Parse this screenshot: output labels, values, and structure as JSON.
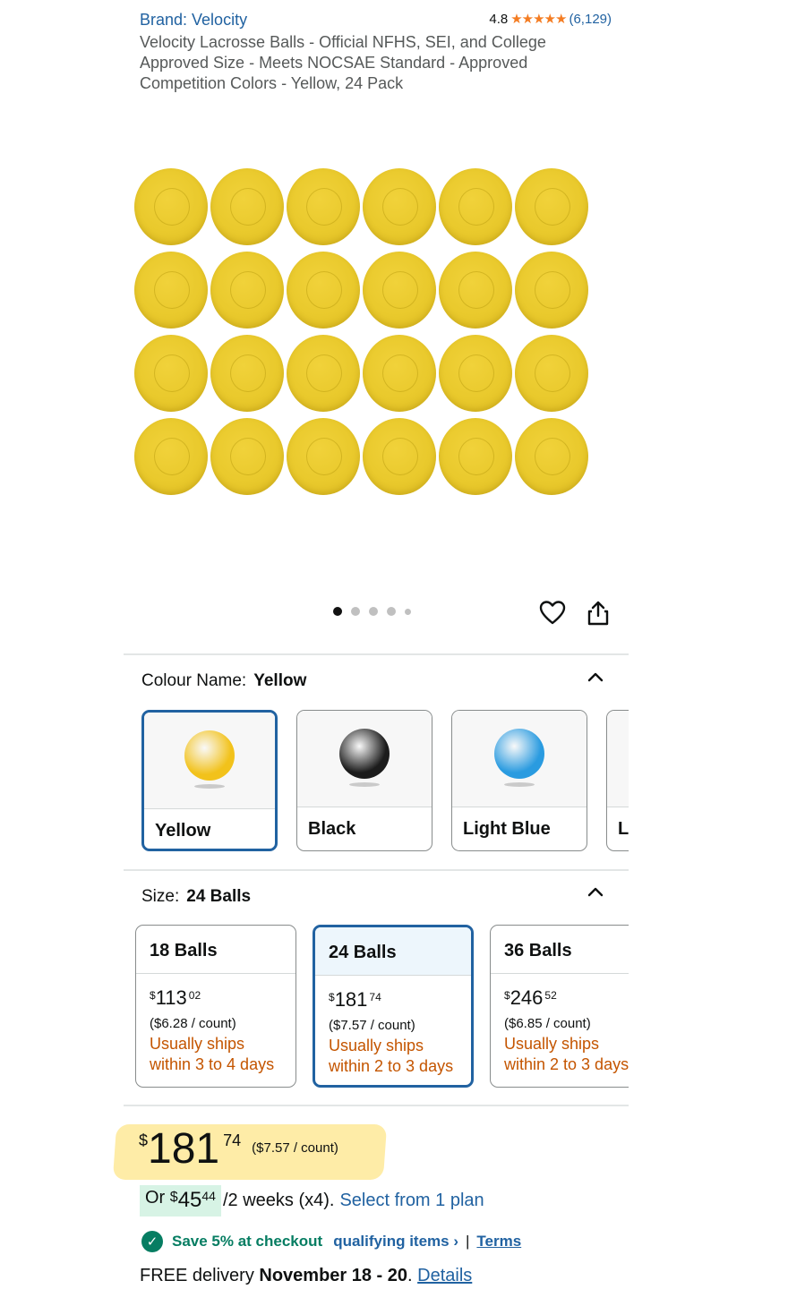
{
  "header": {
    "brand": "Brand: Velocity",
    "rating": "4.8",
    "stars": "★★★★★",
    "rating_count": "(6,129)",
    "title": "Velocity Lacrosse Balls - Official NFHS, SEI, and College Approved Size - Meets NOCSAE Standard - Approved Competition Colors - Yellow, 24 Pack"
  },
  "gallery": {
    "image_count": 5,
    "active_index": 0,
    "icons": [
      "heart-icon",
      "share-icon"
    ]
  },
  "colour": {
    "label": "Colour Name:",
    "selected": "Yellow",
    "options": [
      {
        "name": "Yellow",
        "color": "#f2c21b",
        "selected": true
      },
      {
        "name": "Black",
        "color": "#1c1c1c",
        "selected": false
      },
      {
        "name": "Light Blue",
        "color": "#2a9be0",
        "selected": false
      },
      {
        "name": "Li",
        "color": "#ffffff",
        "selected": false
      }
    ]
  },
  "size": {
    "label": "Size:",
    "selected": "24 Balls",
    "options": [
      {
        "name": "18 Balls",
        "price_whole": "113",
        "price_cents": "02",
        "unit": "($6.28 / count)",
        "ship1": "Usually ships",
        "ship2": "within 3 to 4 days"
      },
      {
        "name": "24 Balls",
        "price_whole": "181",
        "price_cents": "74",
        "unit": "($7.57 / count)",
        "ship1": "Usually ships",
        "ship2": "within 2 to 3 days"
      },
      {
        "name": "36 Balls",
        "price_whole": "246",
        "price_cents": "52",
        "unit": "($6.85 / count)",
        "ship1": "Usually ships",
        "ship2": "within 2 to 3 days"
      }
    ]
  },
  "price": {
    "currency": "$",
    "whole": "181",
    "cents": "74",
    "per_count": "($7.57 / count)"
  },
  "plan": {
    "prefix": "Or",
    "currency": "$",
    "whole": "45",
    "cents": "44",
    "rest": "/2 weeks (x4).",
    "link": "Select from 1 plan"
  },
  "save": {
    "text": "Save 5% at checkout",
    "qualifying": "qualifying items ›",
    "sep": "|",
    "terms": "Terms"
  },
  "delivery": {
    "prefix": "FREE delivery",
    "dates": "November 18 - 20",
    "suffix": ".",
    "link": "Details"
  },
  "colors": {
    "link": "#2162a1",
    "ship": "#c45500",
    "selected_border": "#2162a1",
    "success": "#067d62",
    "star": "#f47c22"
  }
}
